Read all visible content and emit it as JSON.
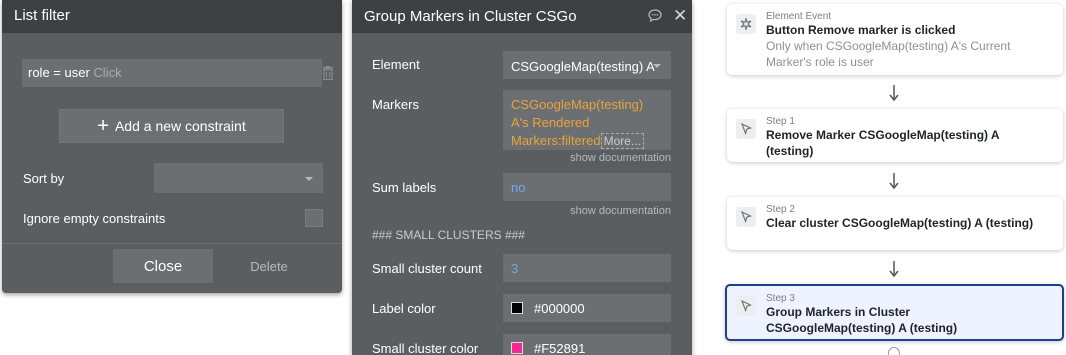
{
  "list_filter": {
    "title": "List filter",
    "constraint_text": "role = user",
    "constraint_placeholder": "Click",
    "add_constraint_label": "Add a new constraint",
    "sort_by_label": "Sort by",
    "sort_by_value": "",
    "ignore_empty_label": "Ignore empty constraints",
    "close_label": "Close",
    "delete_label": "Delete"
  },
  "group_panel": {
    "title": "Group Markers in Cluster CSGoogleMap(testing) A",
    "element_label": "Element",
    "element_value": "CSGoogleMap(testing) A",
    "markers_label": "Markers",
    "markers_value": "CSGoogleMap(testing) A's Rendered Markers:filtered",
    "more_label": "More...",
    "show_documentation": "show documentation",
    "sum_labels_label": "Sum labels",
    "sum_labels_value": "no",
    "section_small": "### SMALL CLUSTERS ###",
    "small_count_label": "Small cluster count",
    "small_count_value": "3",
    "label_color_label": "Label color",
    "label_color_value": "#000000",
    "small_color_label": "Small cluster color",
    "small_color_value": "#F52891"
  },
  "workflow": {
    "event": {
      "kicker": "Element Event",
      "title": "Button Remove marker is clicked",
      "condition": "Only when CSGoogleMap(testing) A's Current Marker's role is user"
    },
    "steps": [
      {
        "kicker": "Step 1",
        "title": "Remove Marker CSGoogleMap(testing) A (testing)"
      },
      {
        "kicker": "Step 2",
        "title": "Clear cluster CSGoogleMap(testing) A (testing)"
      },
      {
        "kicker": "Step 3",
        "title": "Group Markers in Cluster CSGoogleMap(testing) A (testing)"
      }
    ]
  },
  "colors": {
    "panel_bg": "#5b5e61",
    "panel_header": "#3e4144",
    "dynamic_value": "#e8a33d",
    "static_value": "#6aa9ea",
    "active_border": "#1f3e8f",
    "label_swatch": "#000000",
    "small_cluster_swatch": "#F52891"
  }
}
